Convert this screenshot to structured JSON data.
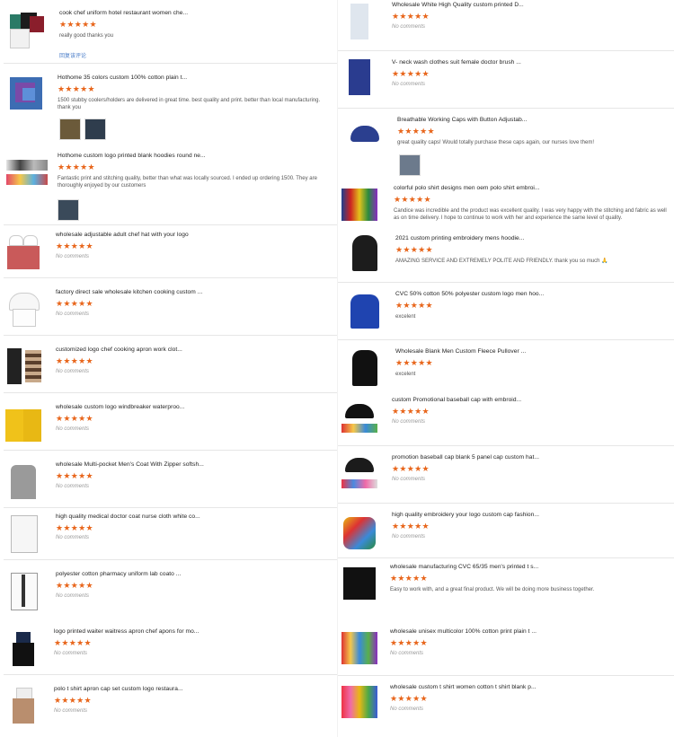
{
  "left": [
    {
      "title": "cook chef uniform hotel restaurant women che...",
      "comment": "really good thanks you",
      "link": "回复该评论"
    },
    {
      "title": "Hothome 35 colors custom 100% cotton plain t...",
      "comment": "1500 stubby coolers/holders are delivered in great time.  best quality and print. better than local manufacturing. thank you"
    },
    {
      "title": "Hothome custom logo printed blank hoodies round ne...",
      "comment": "Fantastic print and stitching quality, better than what was locally sourced. I ended up ordering 1500. They are thoroughly enjoyed by our customers"
    },
    {
      "title": "wholesale adjustable adult chef hat with your logo",
      "comment": "No comments"
    },
    {
      "title": "factory direct sale wholesale kitchen cooking custom ...",
      "comment": "No comments"
    },
    {
      "title": "customized logo chef cooking apron work clot...",
      "comment": "No comments"
    },
    {
      "title": "wholesale custom logo windbreaker waterproo...",
      "comment": "No comments"
    },
    {
      "title": "wholesale Multi-pocket Men's Coat With Zipper softsh...",
      "comment": "No comments"
    },
    {
      "title": "high quality medical doctor coat nurse cloth white co...",
      "comment": "No comments"
    },
    {
      "title": "polyester cotton pharmacy uniform lab coato ...",
      "comment": "No comments"
    },
    {
      "title": "logo printed waiter waitress apron chef apons for mo...",
      "comment": "No comments"
    },
    {
      "title": "polo t shirt apron cap set custom logo restaura...",
      "comment": "No comments"
    }
  ],
  "right": [
    {
      "title": "Wholesale White High Quality custom printed D...",
      "comment": "No comments"
    },
    {
      "title": "V- neck wash clothes suit female doctor brush ...",
      "comment": "No comments"
    },
    {
      "title": "Breathable Working Caps with Button Adjustab...",
      "comment": "great quality caps! Would totally purchase these caps again, our nurses love them!"
    },
    {
      "title": "colorful polo shirt designs men oem polo shirt embroi...",
      "comment": "Candice was incredible and the product was excellent quality. I was very happy with the stitching and fabric as well as on time delivery. I hope to continue to work with her and experience the same level of quality."
    },
    {
      "title": "2021 custom printing embroidery mens hoodie...",
      "comment": "AMAZING SERVICE AND EXTREMELY POLITE AND FRIENDLY. thank you so much 🙏"
    },
    {
      "title": "CVC 50% cotton 50% polyester custom logo men hoo...",
      "comment": "excelent"
    },
    {
      "title": "Wholesale Blank Men Custom Fleece Pullover ...",
      "comment": "excelent"
    },
    {
      "title": "custom Promotional baseball cap with embroid...",
      "comment": "No comments"
    },
    {
      "title": "promotion baseball cap blank 5 panel cap custom hat...",
      "comment": "No comments"
    },
    {
      "title": "high quality embroidery your logo custom cap fashion...",
      "comment": "No comments"
    },
    {
      "title": "wholesale manufacturing CVC 65/35 men's printed t s...",
      "comment": "Easy to work with, and a great final product. We will be doing more business together."
    },
    {
      "title": "wholesale unisex multicolor 100% cotton print plain t ...",
      "comment": "No comments"
    },
    {
      "title": "wholesale custom t shirt women cotton t shirt blank p...",
      "comment": "No comments"
    }
  ],
  "stars": "★★★★★",
  "colors": {
    "star": "#e8661c",
    "title": "#222222",
    "muted": "#999999",
    "link": "#4a7dc9",
    "separator": "#e6e6e6"
  }
}
